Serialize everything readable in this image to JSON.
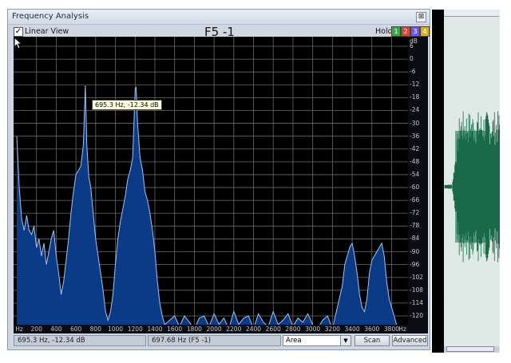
{
  "window": {
    "title": "Frequency Analysis",
    "close_glyph": "⊠"
  },
  "toolbar": {
    "linear_view_checked": true,
    "linear_view_label": "Linear View",
    "trace_title": "F5 -1",
    "hold_label": "Hold",
    "hold_buttons": [
      {
        "label": "1",
        "color": "#3aa84a"
      },
      {
        "label": "2",
        "color": "#d44a3a"
      },
      {
        "label": "3",
        "color": "#6a5bd6"
      },
      {
        "label": "4",
        "color": "#d9b21a"
      }
    ]
  },
  "plot": {
    "background": "#000000",
    "grid_color": "#6a6a6a",
    "fill_color": "#0b3a86",
    "line_color": "#9fc3f0",
    "y_axis_unit": "dB",
    "y_ticks": [
      "6",
      "0",
      "-6",
      "-12",
      "-18",
      "-24",
      "-30",
      "-36",
      "-42",
      "-48",
      "-54",
      "-60",
      "-66",
      "-72",
      "-78",
      "-84",
      "-90",
      "-96",
      "-102",
      "-108",
      "-114",
      "-120"
    ],
    "x_axis_unit": "Hz",
    "x_ticks": [
      "200",
      "400",
      "600",
      "800",
      "1000",
      "1200",
      "1400",
      "1600",
      "1800",
      "2000",
      "2200",
      "2400",
      "2600",
      "2800",
      "3000",
      "3200",
      "3400",
      "3600",
      "3800"
    ],
    "tooltip": "695.3 Hz, -12.34 dB",
    "spectrum": {
      "freq_hz": [
        0,
        25,
        50,
        75,
        100,
        125,
        150,
        175,
        200,
        225,
        250,
        275,
        300,
        325,
        350,
        375,
        400,
        425,
        450,
        475,
        500,
        525,
        550,
        575,
        600,
        625,
        650,
        675,
        695,
        710,
        730,
        750,
        775,
        800,
        825,
        850,
        875,
        900,
        925,
        950,
        975,
        1000,
        1025,
        1050,
        1075,
        1100,
        1125,
        1150,
        1175,
        1200,
        1210,
        1225,
        1250,
        1275,
        1300,
        1325,
        1350,
        1375,
        1400,
        1425,
        1450,
        1475,
        1500,
        1550,
        1600,
        1650,
        1700,
        1750,
        1800,
        1850,
        1900,
        1950,
        2000,
        2050,
        2100,
        2150,
        2200,
        2250,
        2300,
        2350,
        2400,
        2450,
        2500,
        2550,
        2600,
        2650,
        2700,
        2750,
        2800,
        2850,
        2900,
        2950,
        3000,
        3050,
        3100,
        3150,
        3200,
        3250,
        3300,
        3325,
        3350,
        3375,
        3400,
        3425,
        3450,
        3475,
        3500,
        3525,
        3550,
        3575,
        3600,
        3625,
        3650,
        3675,
        3700,
        3725,
        3750,
        3775,
        3800,
        3825,
        3850,
        3875,
        3900,
        3925,
        3950
      ],
      "db": [
        -36,
        -60,
        -75,
        -80,
        -73,
        -80,
        -82,
        -78,
        -88,
        -84,
        -92,
        -86,
        -96,
        -90,
        -84,
        -80,
        -92,
        -100,
        -110,
        -104,
        -94,
        -84,
        -72,
        -62,
        -54,
        -52,
        -50,
        -40,
        -12.3,
        -40,
        -55,
        -60,
        -72,
        -84,
        -92,
        -100,
        -108,
        -118,
        -122,
        -118,
        -110,
        -96,
        -84,
        -76,
        -70,
        -64,
        -56,
        -52,
        -46,
        -14,
        -13,
        -30,
        -46,
        -52,
        -62,
        -66,
        -72,
        -80,
        -90,
        -104,
        -114,
        -120,
        -124,
        -122,
        -120,
        -125,
        -120,
        -123,
        -126,
        -121,
        -120,
        -125,
        -119,
        -124,
        -121,
        -126,
        -118,
        -124,
        -121,
        -120,
        -126,
        -119,
        -123,
        -125,
        -118,
        -124,
        -122,
        -119,
        -125,
        -121,
        -123,
        -119,
        -124,
        -126,
        -122,
        -120,
        -126,
        -116,
        -106,
        -96,
        -92,
        -88,
        -86,
        -92,
        -100,
        -110,
        -116,
        -118,
        -112,
        -100,
        -94,
        -92,
        -90,
        -88,
        -86,
        -92,
        -104,
        -112,
        -116,
        -120,
        -124,
        -126,
        -127,
        -128,
        -128
      ]
    }
  },
  "statusbar": {
    "cursor_readout": "695.3 Hz, -12.34 dB",
    "peak_readout": "697.68 Hz (F5 -1)",
    "mode_select_value": "Area",
    "scan_button": "Scan",
    "advanced_button": "Advanced"
  },
  "waveform_panel": {
    "wave_color": "#1a6a4a",
    "background": "#dfe9e6"
  }
}
